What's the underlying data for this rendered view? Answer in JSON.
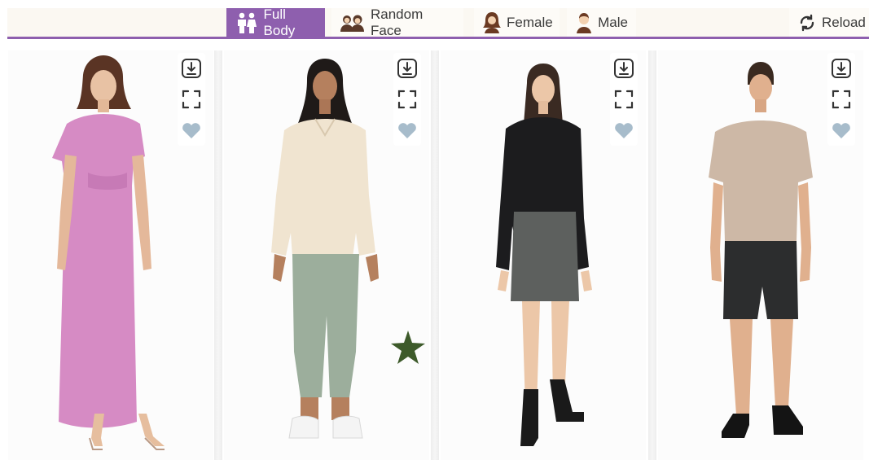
{
  "toolbar": {
    "tabs": [
      {
        "label": "Full Body",
        "icon": "two-people-icon",
        "active": true
      },
      {
        "label": "Random Face",
        "icon": "faces-icon",
        "active": false
      },
      {
        "label": "Female",
        "icon": "female-icon",
        "active": false
      },
      {
        "label": "Male",
        "icon": "male-icon",
        "active": false
      }
    ],
    "reload": {
      "label": "Reload",
      "icon": "reload-icon"
    },
    "accent_color": "#8e5fae"
  },
  "gallery": {
    "cards": [
      {
        "subject": "woman in pink midi dress with strappy heels",
        "actions": [
          "download-icon",
          "fullscreen-icon",
          "heart-icon"
        ]
      },
      {
        "subject": "woman in cream blouse, sage trousers and white sneakers",
        "actions": [
          "download-icon",
          "fullscreen-icon",
          "heart-icon"
        ]
      },
      {
        "subject": "woman in black sweater, grey shorts and black boots",
        "actions": [
          "download-icon",
          "fullscreen-icon",
          "heart-icon"
        ]
      },
      {
        "subject": "man in beige t-shirt, charcoal shorts and black shoes",
        "actions": [
          "download-icon",
          "fullscreen-icon",
          "heart-icon"
        ]
      }
    ],
    "overlay_icon": "star-icon",
    "overlay_color": "#3d5a2a"
  }
}
